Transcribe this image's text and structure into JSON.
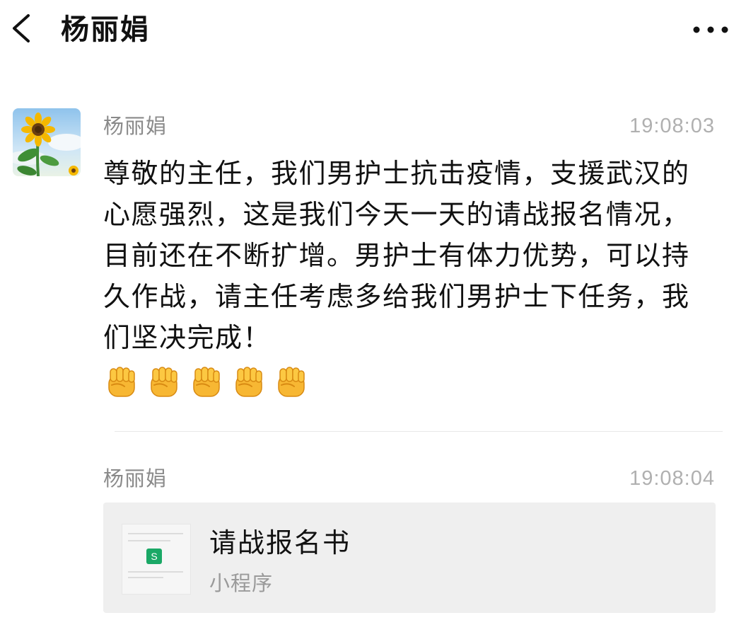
{
  "header": {
    "title": "杨丽娟",
    "back_icon": "chevron-left-icon",
    "more_icon": "more-dots-icon"
  },
  "messages": [
    {
      "sender": "杨丽娟",
      "time": "19:08:03",
      "text": "尊敬的主任，我们男护士抗击疫情，支援武汉的心愿强烈，这是我们今天一天的请战报名情况，目前还在不断扩增。男护士有体力优势，可以持久作战，请主任考虑多给我们男护士下任务，我们坚决完成！",
      "emoji_icon": "fist-emoji-icon",
      "emoji_count": 5
    },
    {
      "sender": "杨丽娟",
      "time": "19:08:04",
      "card": {
        "title": "请战报名书",
        "subtitle": "小程序",
        "thumb_logo": "S"
      }
    }
  ],
  "colors": {
    "background": "#ffffff",
    "card_background": "#efefef",
    "name_gray": "#8a8a8a",
    "time_gray": "#b0b0b0",
    "accent_green": "#1aa866"
  }
}
